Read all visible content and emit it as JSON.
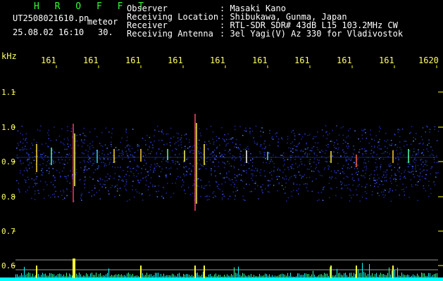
{
  "header": {
    "program": "H R O F F T",
    "filename": "UT2508021610.pn",
    "meteor": "meteor",
    "datetime": "25.08.02 16:10",
    "interval": "30.",
    "labels": [
      "Observer",
      "Receiving Location",
      "Receiver",
      "Receiving Antenna"
    ],
    "values": [
      ": Masaki Kano",
      ": Shibukawa, Gunma, Japan",
      ": RTL-SDR SDR# 43dB L15 103.2MHz CW",
      ": 3el Yagi(V) Az 330 for Vladivostok"
    ]
  },
  "axis": {
    "unit": "kHz",
    "time_ticks": [
      "161",
      "161",
      "161",
      "161",
      "161",
      "161",
      "161",
      "161",
      "161",
      "1620"
    ],
    "freq_ticks": [
      "1.1",
      "1.0",
      "0.9",
      "0.8",
      "0.7",
      "0.6"
    ]
  },
  "colors": {
    "text": "#ffffff",
    "label": "#ffff66",
    "title": "#33ff33",
    "tick": "#ffff00",
    "noise": "#1a2a9a",
    "bottom": "#00ffff"
  }
}
